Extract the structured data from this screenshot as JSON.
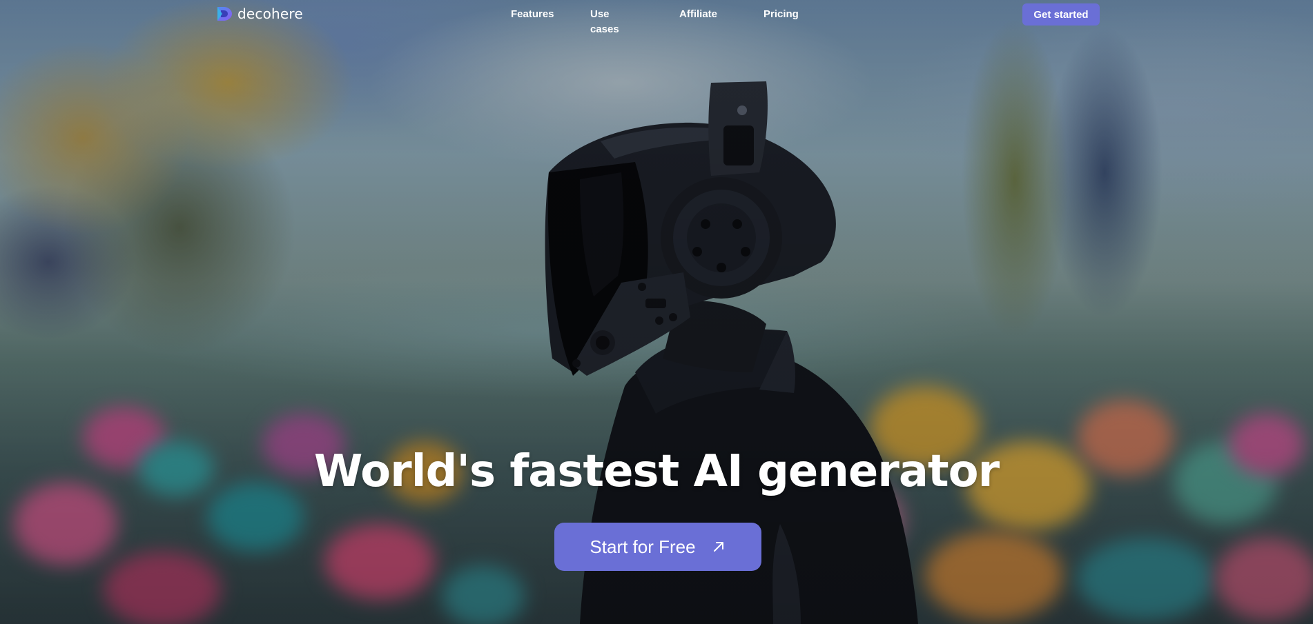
{
  "brand": {
    "name": "decohere",
    "logo_icon": "decohere-logo-icon",
    "accent_color": "#6a6fd6"
  },
  "nav": {
    "links": [
      {
        "label": "Features"
      },
      {
        "label": "Use cases"
      },
      {
        "label": "Affiliate"
      },
      {
        "label": "Pricing"
      }
    ],
    "cta_label": "Get started"
  },
  "hero": {
    "title": "World's fastest AI generator",
    "cta_label": "Start for Free",
    "cta_icon": "arrow-up-right-icon",
    "background_image": "impressionist painting of a figure in a black helmet with headphones in a flower field"
  }
}
